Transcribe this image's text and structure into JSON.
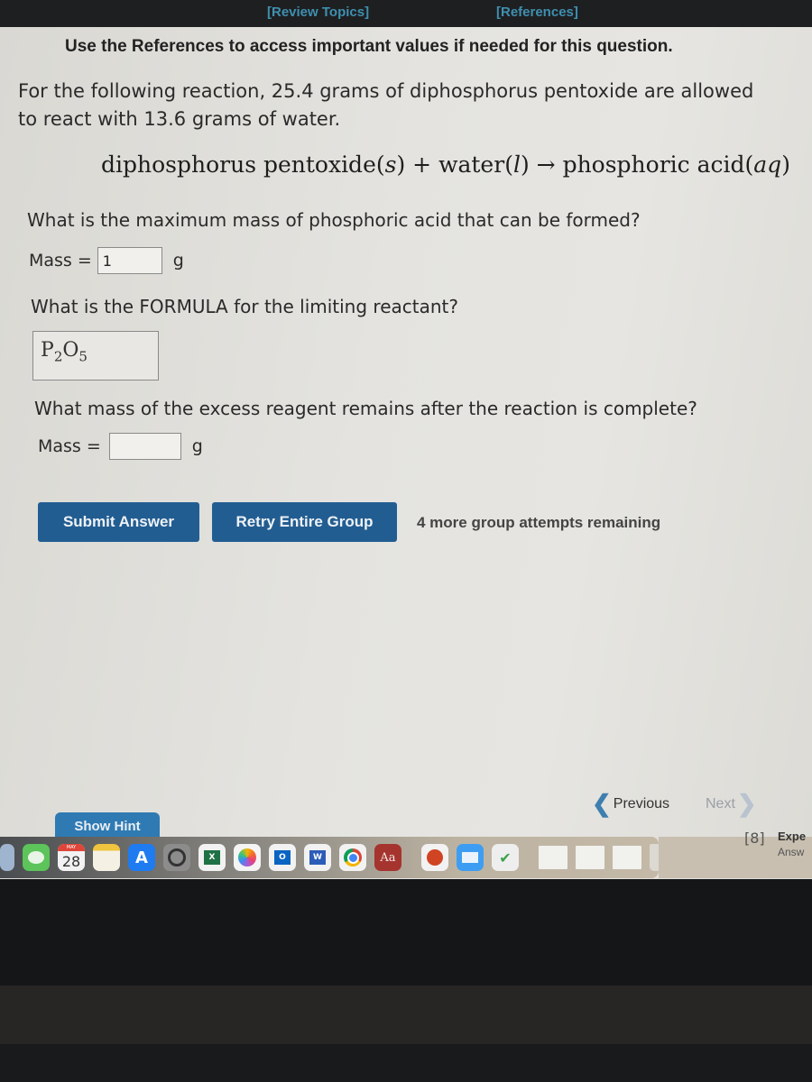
{
  "header": {
    "review_topics_link": "[Review Topics]",
    "references_link": "[References]",
    "notice": "Use the References to access important values if needed for this question."
  },
  "problem": {
    "intro": "For the following reaction, 25.4 grams of diphosphorus pentoxide are allowed to react with 13.6 grams of water.",
    "equation": {
      "reactant1": "diphosphorus pentoxide",
      "reactant1_state": "s",
      "plus": "+",
      "reactant2": "water",
      "reactant2_state": "l",
      "arrow": "→",
      "product": "phosphoric acid",
      "product_state": "aq"
    }
  },
  "questions": {
    "q1": {
      "text": "What is the maximum mass of phosphoric acid that can be formed?",
      "label": "Mass =",
      "value": "1",
      "unit": "g"
    },
    "q2": {
      "text": "What is the FORMULA for the limiting reactant?",
      "formula": {
        "el1": "P",
        "sub1": "2",
        "el2": "O",
        "sub2": "5"
      }
    },
    "q3": {
      "text": "What mass of the excess reagent remains after the reaction is complete?",
      "label": "Mass =",
      "value": "",
      "unit": "g"
    }
  },
  "actions": {
    "submit_label": "Submit Answer",
    "retry_label": "Retry Entire Group",
    "attempts_text": "4 more group attempts remaining",
    "hint_label": "Show Hint",
    "previous_label": "Previous",
    "next_label": "Next"
  },
  "dock": {
    "calendar_day": "28",
    "calendar_month": "MAY",
    "dictionary_label": "Aa",
    "apps": [
      "finder",
      "messages",
      "calendar",
      "notes",
      "app-store",
      "system-settings",
      "excel",
      "photos",
      "outlook",
      "word",
      "chrome",
      "dictionary",
      "powerpoint",
      "mail",
      "adguard",
      "document-1",
      "document-2",
      "document-3",
      "trash"
    ]
  },
  "side_panel": {
    "title": "Expe",
    "subtitle": "Answ"
  },
  "colors": {
    "link": "#3f8fb0",
    "button": "#225d91",
    "hint_button": "#2f7ab3"
  }
}
